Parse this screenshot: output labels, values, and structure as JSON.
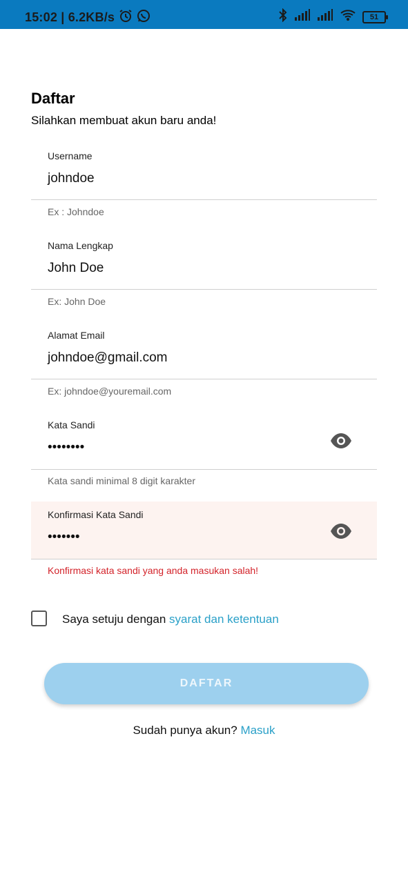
{
  "status_bar": {
    "time": "15:02",
    "speed": "6.2KB/s",
    "battery": "51"
  },
  "page": {
    "title": "Daftar",
    "subtitle": "Silahkan membuat akun baru anda!"
  },
  "fields": [
    {
      "label": "Username",
      "value": "johndoe",
      "helper": "Ex : Johndoe"
    },
    {
      "label": "Nama Lengkap",
      "value": "John Doe",
      "helper": "Ex: John Doe"
    },
    {
      "label": "Alamat Email",
      "value": "johndoe@gmail.com",
      "helper": "Ex: johndoe@youremail.com"
    },
    {
      "label": "Kata Sandi",
      "value": "••••••••",
      "helper": "Kata sandi minimal 8 digit karakter"
    },
    {
      "label": "Konfirmasi Kata Sandi",
      "value": "•••••••",
      "helper": "Konfirmasi kata sandi yang anda masukan salah!"
    }
  ],
  "agreement": {
    "text": "Saya setuju dengan ",
    "link": "syarat dan ketentuan",
    "checked": false
  },
  "submit_label": "DAFTAR",
  "login_prompt": {
    "text": "Sudah punya akun? ",
    "link": "Masuk"
  },
  "colors": {
    "status_bar": "#0a7abf",
    "button": "#9dd0ee",
    "link": "#2aa0c8",
    "error": "#d3232a",
    "error_background": "#fdf3f0"
  }
}
